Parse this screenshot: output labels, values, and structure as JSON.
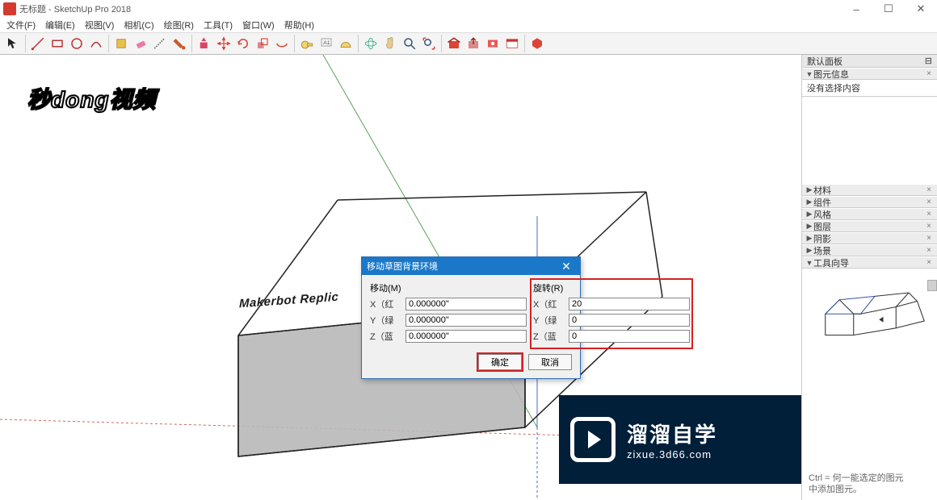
{
  "window": {
    "title": "无标题 - SketchUp Pro 2018",
    "min": "–",
    "max": "☐",
    "close": "✕"
  },
  "menu": {
    "file": "文件(F)",
    "edit": "编辑(E)",
    "view": "视图(V)",
    "camera": "相机(C)",
    "draw": "绘图(R)",
    "tool": "工具(T)",
    "window": "窗口(W)",
    "help": "帮助(H)"
  },
  "model_text": "Makerbot Replic",
  "rightpanel": {
    "header": "默认面板",
    "header_pin": "⊟",
    "s_entity": "图元信息",
    "entity_body": "没有选择内容",
    "s_material": "材料",
    "s_component": "组件",
    "s_style": "风格",
    "s_layer": "图层",
    "s_shadow": "阴影",
    "s_scene": "场景",
    "s_instructor": "工具向导",
    "instructor_text1": "Ctrl = 何一能选定的图元",
    "instructor_text2": "中添加图元。"
  },
  "dialog": {
    "title": "移动草图背景环境",
    "close": "✕",
    "move_group": "移动(M)",
    "rotate_group": "旋转(R)",
    "x_label": "X（红",
    "y_label": "Y（绿",
    "z_label": "Z（蓝",
    "move_x": "0.000000\"",
    "move_y": "0.000000\"",
    "move_z": "0.000000\"",
    "rot_x": "20",
    "rot_y": "0",
    "rot_z": "0",
    "ok": "确定",
    "cancel": "取消"
  },
  "overlay1": "秒dong视频",
  "overlay2": {
    "line1": "溜溜自学",
    "line2": "zixue.3d66.com"
  }
}
